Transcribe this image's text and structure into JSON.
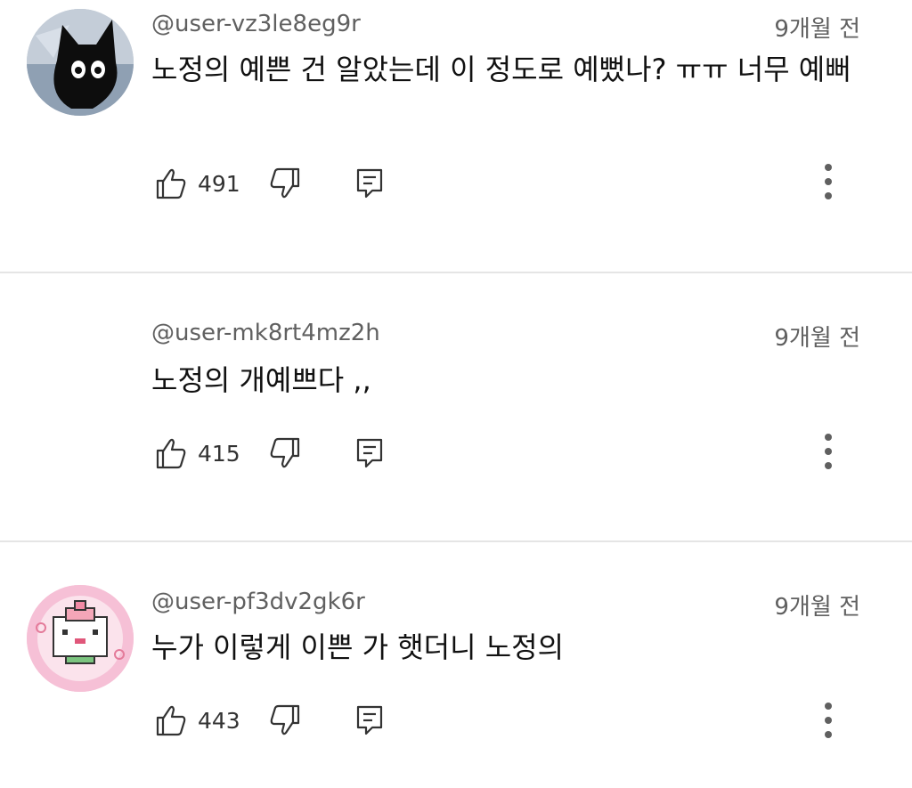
{
  "comments": [
    {
      "username": "@user-vz3le8eg9r",
      "time": "9개월 전",
      "text": "노정의 예쁜 건 알았는데 이 정도로 예뻤나? ㅠㅠ 너무 예뻐",
      "likes": "491",
      "avatar": "black-cat-avatar"
    },
    {
      "username": "@user-mk8rt4mz2h",
      "time": "9개월 전",
      "text": "노정의 개예쁘다 ,,",
      "likes": "415",
      "avatar": "none"
    },
    {
      "username": "@user-pf3dv2gk6r",
      "time": "9개월 전",
      "text": "누가 이렇게 이쁜 가 햇더니 노정의",
      "likes": "443",
      "avatar": "pixel-peach-avatar"
    }
  ],
  "icons": {
    "like": "thumb-up-icon",
    "dislike": "thumb-down-icon",
    "reply": "reply-icon",
    "more": "more-vert-icon"
  },
  "colors": {
    "meta": "#606060",
    "divider": "#e5e5e5",
    "icon": "#333333"
  }
}
